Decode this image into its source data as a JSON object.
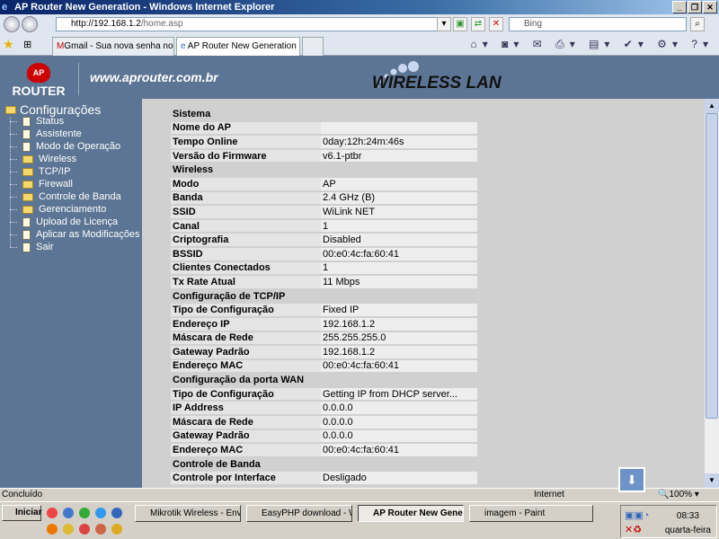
{
  "window": {
    "title": "AP Router New Generation - Windows Internet Explorer"
  },
  "browser": {
    "address": "http://192.168.1.2/home.asp",
    "address_host": "http://192.168.1.2",
    "address_path": "/home.asp",
    "search_placeholder": "Bing",
    "tabs": [
      {
        "label": "Gmail - Sua nova senha no U..."
      },
      {
        "label": "AP Router New Generation"
      }
    ]
  },
  "header": {
    "logo": "ROUTER",
    "logo_badge": "AP",
    "url": "www.aprouter.com.br",
    "banner": "WIRELESS LAN"
  },
  "sidebar": {
    "root": "Configurações",
    "items": [
      {
        "label": "Status",
        "type": "page"
      },
      {
        "label": "Assistente",
        "type": "page"
      },
      {
        "label": "Modo de Operação",
        "type": "page"
      },
      {
        "label": "Wireless",
        "type": "folder"
      },
      {
        "label": "TCP/IP",
        "type": "folder"
      },
      {
        "label": "Firewall",
        "type": "folder"
      },
      {
        "label": "Controle de Banda",
        "type": "folder"
      },
      {
        "label": "Gerenciamento",
        "type": "folder"
      },
      {
        "label": "Upload de Licença",
        "type": "page"
      },
      {
        "label": "Aplicar as Modificações",
        "type": "page"
      },
      {
        "label": "Sair",
        "type": "page"
      }
    ]
  },
  "status_table": [
    {
      "section": "Sistema"
    },
    {
      "label": "Nome do AP",
      "value": ""
    },
    {
      "label": "Tempo Online",
      "value": "0day:12h:24m:46s"
    },
    {
      "label": "Versão do Firmware",
      "value": "v6.1-ptbr"
    },
    {
      "section": "Wireless"
    },
    {
      "label": "Modo",
      "value": "AP"
    },
    {
      "label": "Banda",
      "value": "2.4 GHz (B)"
    },
    {
      "label": "SSID",
      "value": "WiLink NET"
    },
    {
      "label": "Canal",
      "value": "1"
    },
    {
      "label": "Criptografia",
      "value": "Disabled"
    },
    {
      "label": "BSSID",
      "value": "00:e0:4c:fa:60:41"
    },
    {
      "label": "Clientes Conectados",
      "value": "1"
    },
    {
      "label": "Tx Rate Atual",
      "value": "11 Mbps"
    },
    {
      "section": "Configuração de TCP/IP"
    },
    {
      "label": "Tipo de Configuração",
      "value": "Fixed IP"
    },
    {
      "label": "Endereço IP",
      "value": "192.168.1.2"
    },
    {
      "label": "Máscara de Rede",
      "value": "255.255.255.0"
    },
    {
      "label": "Gateway Padrão",
      "value": "192.168.1.2"
    },
    {
      "label": "Endereço MAC",
      "value": "00:e0:4c:fa:60:41"
    },
    {
      "section": "Configuração da porta WAN"
    },
    {
      "label": "Tipo de Configuração",
      "value": "Getting IP from DHCP server..."
    },
    {
      "label": "IP Address",
      "value": "0.0.0.0"
    },
    {
      "label": "Máscara de Rede",
      "value": "0.0.0.0"
    },
    {
      "label": "Gateway Padrão",
      "value": "0.0.0.0"
    },
    {
      "label": "Endereço MAC",
      "value": "00:e0:4c:fa:60:41"
    },
    {
      "section": "Controle de Banda"
    },
    {
      "label": "Controle por Interface",
      "value": "Desligado"
    }
  ],
  "statusbar": {
    "text": "Concluído",
    "zone": "Internet",
    "zoom": "100%"
  },
  "taskbar": {
    "start": "Iniciar",
    "tasks": [
      "Mikrotik Wireless - Enviar...",
      "EasyPHP download - Win...",
      "AP Router New Gener...",
      "imagem - Paint"
    ],
    "time": "08:33",
    "day": "quarta-feira"
  }
}
